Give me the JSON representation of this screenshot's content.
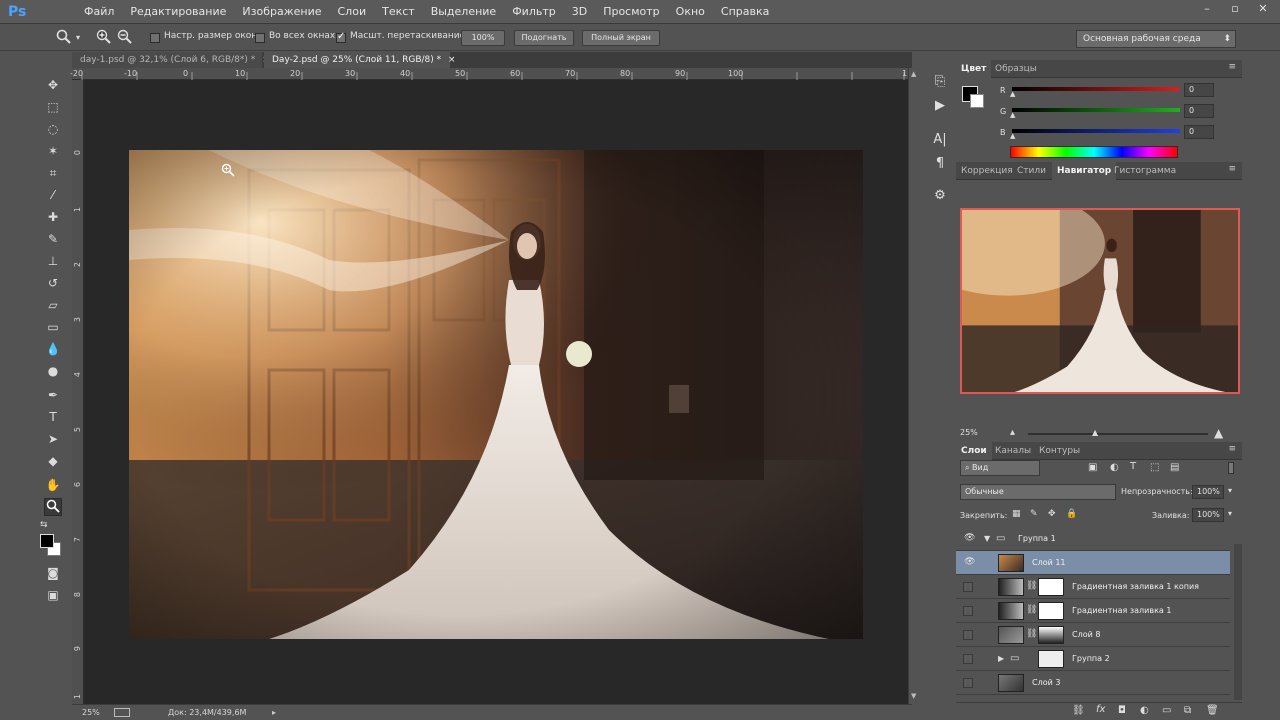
{
  "app": {
    "logo": "Ps",
    "menu": [
      "Файл",
      "Редактирование",
      "Изображение",
      "Слои",
      "Текст",
      "Выделение",
      "Фильтр",
      "3D",
      "Просмотр",
      "Окно",
      "Справка"
    ]
  },
  "window_controls": [
    "–",
    "▫",
    "✕"
  ],
  "options": {
    "zoom_icon": "zoom-icon",
    "resize_windows": "Настр. размер окон",
    "all_windows": "Во всех окнах",
    "scrubby_zoom": "Масшт. перетаскиванием",
    "percent_btn": "100%",
    "fit_btn": "Подогнать",
    "fullscreen_btn": "Полный экран",
    "workspace": "Основная рабочая среда"
  },
  "tabs": [
    {
      "label": "day-1.psd @ 32,1% (Слой 6, RGB/8*) *",
      "close": "×"
    },
    {
      "label": "Day-2.psd @ 25% (Слой 11, RGB/8) *",
      "close": "×"
    }
  ],
  "ruler": {
    "top": [
      "-20",
      "-10",
      "0",
      "10",
      "20",
      "30",
      "40",
      "50",
      "60",
      "70",
      "80",
      "90",
      "100",
      "1"
    ],
    "left": [
      "0",
      "1",
      "2",
      "3",
      "4",
      "5",
      "6",
      "7",
      "8",
      "9",
      "1",
      "1"
    ]
  },
  "status": {
    "zoom": "25%",
    "doc": "Док: 23,4M/439,6M"
  },
  "color_panel": {
    "tabs": [
      "Цвет",
      "Образцы"
    ],
    "channels": [
      {
        "name": "R",
        "value": "0",
        "color": "#d62020"
      },
      {
        "name": "G",
        "value": "0",
        "color": "#20b020"
      },
      {
        "name": "B",
        "value": "0",
        "color": "#2040e0"
      }
    ]
  },
  "adj_panel": {
    "tabs": [
      "Коррекция",
      "Стили",
      "Навигатор",
      "Гистограмма"
    ],
    "zoom": "25%"
  },
  "layers_panel": {
    "tabs": [
      "Слои",
      "Каналы",
      "Контуры"
    ],
    "filter": "Вид",
    "blend_mode": "Обычные",
    "opacity_label": "Непрозрачность:",
    "opacity": "100%",
    "lock_label": "Закрепить:",
    "fill_label": "Заливка:",
    "fill": "100%",
    "layers": [
      {
        "name": "Группа 1",
        "visible": true,
        "type": "group-open"
      },
      {
        "name": "Слой 11",
        "visible": true,
        "type": "layer",
        "selected": true
      },
      {
        "name": "Градиентная заливка 1 копия",
        "visible": false,
        "type": "fill"
      },
      {
        "name": "Градиентная заливка 1",
        "visible": false,
        "type": "fill"
      },
      {
        "name": "Слой 8",
        "visible": false,
        "type": "masked"
      },
      {
        "name": "Группа 2",
        "visible": false,
        "type": "group-closed"
      },
      {
        "name": "Слой 3",
        "visible": false,
        "type": "layer"
      }
    ]
  },
  "colors": {
    "accent": "#4aa3ff",
    "selected_layer": "#7b8ea8",
    "navigator_frame": "#e05a55"
  }
}
